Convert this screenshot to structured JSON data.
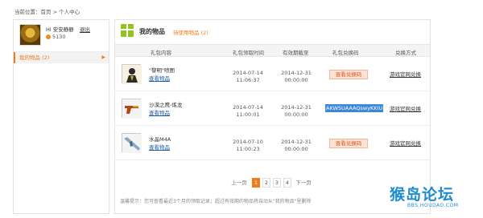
{
  "breadcrumb": "当前位置：首页 > 个人中心",
  "user": {
    "name": "Hi 安安静静",
    "logout_label": "退出",
    "coins": "5130"
  },
  "sidebar": {
    "items": [
      {
        "label": "我的物品",
        "count": "(2)",
        "arrow": "▶"
      }
    ]
  },
  "panel": {
    "title": "我的物品",
    "pending_link": "待使用物品 (2)"
  },
  "table": {
    "headers": [
      "礼包内容",
      "礼包领取时间",
      "有效期截至",
      "礼包兑换码",
      "兑换方式"
    ],
    "rows": [
      {
        "name": "\"黎明\"喷图",
        "view_label": "查看物品",
        "claim_date": "2014-07-14",
        "claim_time": "11:06:37",
        "expire_date": "2014-12-31",
        "expire_time": "00:00:00",
        "code_button": "查看兑换码",
        "exchange_link": "游戏官网兑换",
        "thumb_icon": "figure-icon"
      },
      {
        "name": "沙漠之鹰-炼龙",
        "view_label": "查看物品",
        "claim_date": "2014-07-14",
        "claim_time": "11:00:01",
        "expire_date": "2014-12-31",
        "expire_time": "00:00:00",
        "code_value": "AKWSUAAAQswyKKIU",
        "exchange_link": "游戏官网兑换",
        "thumb_icon": "pistol-icon"
      },
      {
        "name": "水晶M4A",
        "view_label": "查看物品",
        "claim_date": "2014-07-10",
        "claim_time": "11:00:23",
        "expire_date": "2014-12-31",
        "expire_time": "00:00:00",
        "code_button": "查看兑换码",
        "exchange_link": "游戏官网兑换",
        "thumb_icon": "rifle-icon"
      }
    ]
  },
  "pagination": {
    "prev": "上一页",
    "pages": [
      "1",
      "2",
      "3",
      "4"
    ],
    "current": "1",
    "next": "下一页"
  },
  "tip": "温馨提示：您可查看最近3个月的领取记录；超过有效期的物品将自动从\"我的物品\"里删除",
  "watermark": {
    "main": "猴岛论坛",
    "sub": "BBS.HOUDAO.COM"
  },
  "colors": {
    "accent": "#f07b1d",
    "link": "#1e5aa8",
    "highlight": "#3b87d8",
    "gift": "#8fc31f",
    "watermark": "#1f8bd0"
  }
}
